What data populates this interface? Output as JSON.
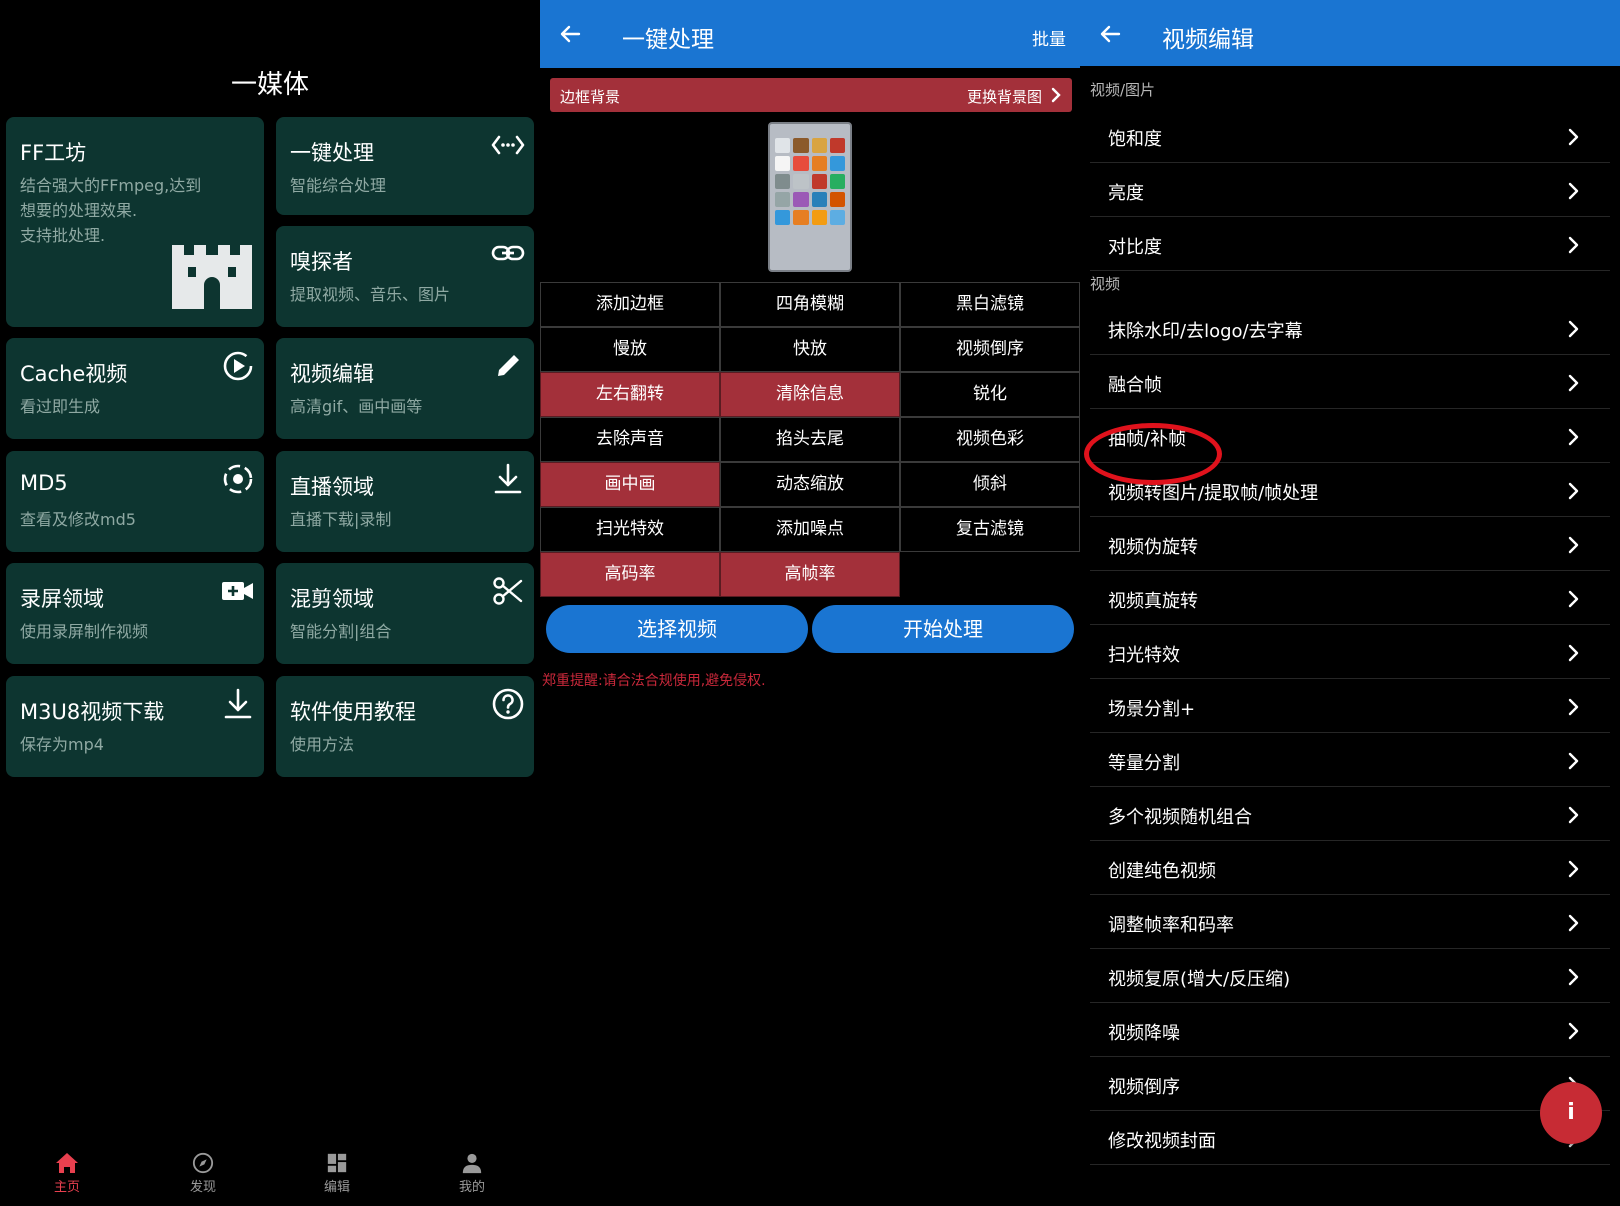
{
  "home": {
    "title": "一媒体",
    "cards": [
      {
        "title": "FF工坊",
        "subtitle_lines": [
          "结合强大的FFmpeg,达到",
          "想要的处理效果.",
          "支持批处理."
        ],
        "icon": "castle-icon"
      },
      {
        "title": "一键处理",
        "subtitle": "智能综合处理",
        "icon": "code-arrows-icon"
      },
      {
        "title": "嗅探者",
        "subtitle": "提取视频、音乐、图片",
        "icon": "link-icon"
      },
      {
        "title": "Cache视频",
        "subtitle": "看过即生成",
        "icon": "play-circle-icon"
      },
      {
        "title": "视频编辑",
        "subtitle": "高清gif、画中画等",
        "icon": "pencil-icon"
      },
      {
        "title": "MD5",
        "subtitle": "查看及修改md5",
        "icon": "target-icon"
      },
      {
        "title": "直播领域",
        "subtitle": "直播下载|录制",
        "icon": "download-icon"
      },
      {
        "title": "录屏领域",
        "subtitle": "使用录屏制作视频",
        "icon": "video-camera-icon"
      },
      {
        "title": "混剪领域",
        "subtitle": "智能分割|组合",
        "icon": "scissors-icon"
      },
      {
        "title": "M3U8视频下载",
        "subtitle": "保存为mp4",
        "icon": "download-icon"
      },
      {
        "title": "软件使用教程",
        "subtitle": "使用方法",
        "icon": "help-circle-icon"
      }
    ],
    "nav": [
      {
        "label": "主页",
        "icon": "home-icon",
        "active": true
      },
      {
        "label": "发现",
        "icon": "compass-icon",
        "active": false
      },
      {
        "label": "编辑",
        "icon": "grid-icon",
        "active": false
      },
      {
        "label": "我的",
        "icon": "person-icon",
        "active": false
      }
    ],
    "accent": "#e8404f",
    "card_color": "#0d3530"
  },
  "batch": {
    "title": "一键处理",
    "action": "批量",
    "border_label": "边框背景",
    "change_bg": "更换背景图",
    "options": [
      {
        "label": "添加边框",
        "on": false
      },
      {
        "label": "四角模糊",
        "on": false
      },
      {
        "label": "黑白滤镜",
        "on": false
      },
      {
        "label": "慢放",
        "on": false
      },
      {
        "label": "快放",
        "on": false
      },
      {
        "label": "视频倒序",
        "on": false
      },
      {
        "label": "左右翻转",
        "on": true
      },
      {
        "label": "清除信息",
        "on": true
      },
      {
        "label": "锐化",
        "on": false
      },
      {
        "label": "去除声音",
        "on": false
      },
      {
        "label": "掐头去尾",
        "on": false
      },
      {
        "label": "视频色彩",
        "on": false
      },
      {
        "label": "画中画",
        "on": true
      },
      {
        "label": "动态缩放",
        "on": false
      },
      {
        "label": "倾斜",
        "on": false
      },
      {
        "label": "扫光特效",
        "on": false
      },
      {
        "label": "添加噪点",
        "on": false
      },
      {
        "label": "复古滤镜",
        "on": false
      },
      {
        "label": "高码率",
        "on": true
      },
      {
        "label": "高帧率",
        "on": true
      }
    ],
    "select_video": "选择视频",
    "start": "开始处理",
    "warning": "郑重提醒:请合法合规使用,避免侵权.",
    "active_color": "#a3303a",
    "primary_color": "#1a75d2"
  },
  "editor": {
    "title": "视频编辑",
    "section1": "视频/图片",
    "items1": [
      "饱和度",
      "亮度",
      "对比度"
    ],
    "section2": "视频",
    "items2": [
      "抹除水印/去logo/去字幕",
      "融合帧",
      "抽帧/补帧",
      "视频转图片/提取帧/帧处理",
      "视频伪旋转",
      "视频真旋转",
      "扫光特效",
      "场景分割+",
      "等量分割",
      "多个视频随机组合",
      "创建纯色视频",
      "调整帧率和码率",
      "视频复原(增大/反压缩)",
      "视频降噪",
      "视频倒序",
      "修改视频封面"
    ],
    "highlighted_item": "抽帧/补帧",
    "fab_label": "i",
    "highlight_color": "#e0121c"
  }
}
